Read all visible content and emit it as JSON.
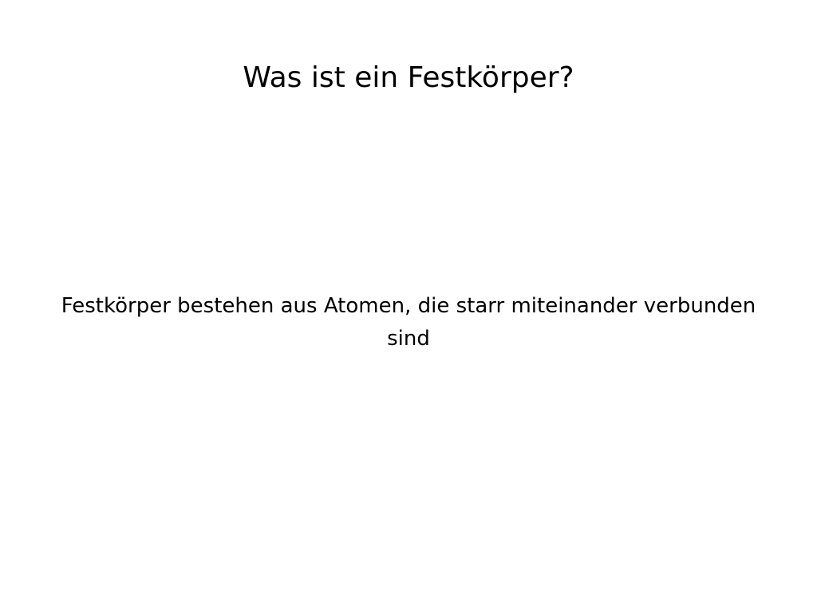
{
  "slide": {
    "title": "Was ist ein Festkörper?",
    "body": "Festkörper bestehen aus Atomen, die starr miteinander verbunden sind"
  }
}
